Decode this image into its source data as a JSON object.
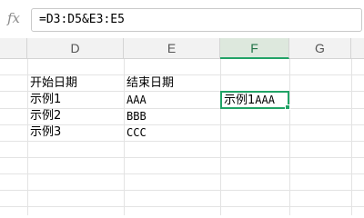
{
  "formula_bar": {
    "icon": "fx-icon",
    "fx_label": "fx",
    "formula": "=D3:D5&E3:E5"
  },
  "columns": [
    "D",
    "E",
    "F",
    "G"
  ],
  "active_column": "F",
  "cells": {
    "D2": "开始日期",
    "E2": "结束日期",
    "D3": "示例1",
    "E3": "AAA",
    "D4": "示例2",
    "E4": "BBB",
    "D5": "示例3",
    "E5": "CCC"
  },
  "selected_cell": {
    "ref": "F3",
    "value_cjk": "示例1",
    "value_latin": "AAA"
  },
  "colors": {
    "accent": "#21a366",
    "header_bg": "#f2f2f2",
    "active_header_bg": "#dde8dd",
    "grid_line": "#e3e3e3"
  }
}
